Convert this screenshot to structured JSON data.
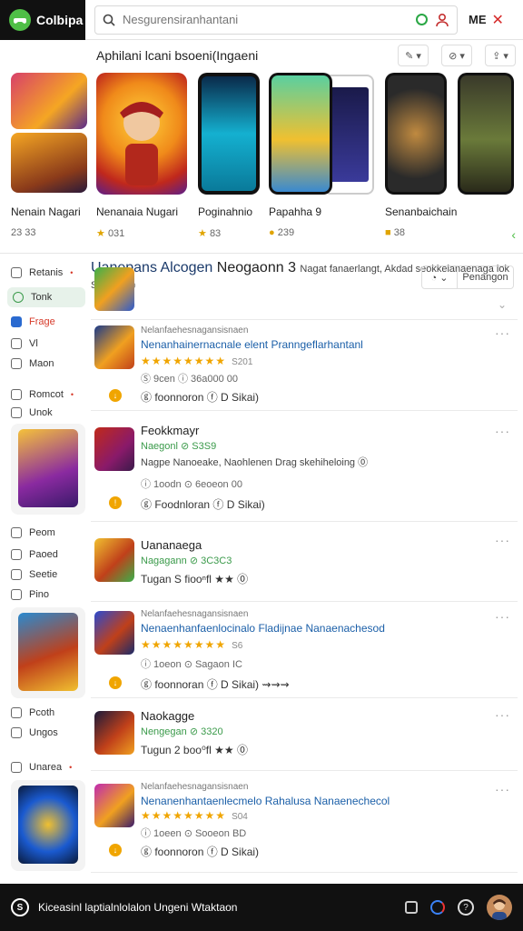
{
  "app": {
    "logo_text": "Colbipa"
  },
  "search": {
    "placeholder": "Nesgurensiranhantani"
  },
  "topbar": {
    "right_label": "ME",
    "close_glyph": "✕"
  },
  "featured": {
    "title": "Aphilani lcani bsoeni(Ingaeni",
    "actions": [
      "✎ ▾",
      "⊘ ▾",
      "⇪ ▾"
    ],
    "cards": [
      {
        "name": "Nenain Nagari",
        "meta_icon": "",
        "meta": "23 33",
        "colors": [
          "#d8406a",
          "#f5a623",
          "#5a2a8a"
        ]
      },
      {
        "name": "Nenanaia Nugari",
        "meta_icon": "★",
        "meta": "031",
        "colors": [
          "#f08a1a",
          "#c0281c",
          "#5a1e8c"
        ]
      },
      {
        "name": "Poginahnio",
        "meta_icon": "★",
        "meta": "83",
        "colors": [
          "#0a7a9a",
          "#14b0d0",
          "#0a2a4a"
        ]
      },
      {
        "name": "Papahha 9",
        "meta_icon": "●",
        "meta": "239",
        "colors": [
          "#5ad0a0",
          "#f0c030",
          "#3a8ad0"
        ]
      },
      {
        "name": "Senanbaichain",
        "meta_icon": "■",
        "meta": "38",
        "colors": [
          "#2a2a2a",
          "#c08a40",
          "#6a6a6a"
        ]
      }
    ]
  },
  "sidebar": {
    "items": [
      {
        "label": "Retanis",
        "marker": "•"
      },
      {
        "label": "Tonk",
        "marker": ""
      },
      {
        "label": "Frage",
        "marker": ""
      },
      {
        "label": "Vl",
        "marker": ""
      },
      {
        "label": "Maon",
        "marker": ""
      },
      {
        "label": "Romcot",
        "marker": "•"
      },
      {
        "label": "Unok",
        "marker": ""
      },
      {
        "label": "Peom",
        "marker": ""
      },
      {
        "label": "Paoed",
        "marker": ""
      },
      {
        "label": "Seetie",
        "marker": ""
      },
      {
        "label": "Pino",
        "marker": ""
      },
      {
        "label": "Pcoth",
        "marker": ""
      },
      {
        "label": "Ungos",
        "marker": ""
      },
      {
        "label": "Unarea",
        "marker": "•"
      }
    ]
  },
  "list": {
    "first": {
      "title": "Uanepans Alcogen",
      "sub": "Neogaonn 3",
      "desc": "Nagat fanaerlangt, Akdad seokkelanaenaga lok Sinpe",
      "desc_suffix": "ooo",
      "btn_icon": "◔ ⌄",
      "btn_label": "Penangon"
    },
    "rows": [
      {
        "kind": "detail",
        "small": "Nelanfaehesnagansisnaen",
        "blue": "Nenanhainernacnale elent Pranngeflarhantanl",
        "stars": "★★★★★★★★",
        "stars_num": "S201",
        "meta": "Ⓢ 9cen ⓘ 36a000 00",
        "foot": "ⓖ foonnoron ⓕ D Sikai)",
        "coin": "↓"
      },
      {
        "kind": "simple",
        "title": "Feokkmayr",
        "sub": "Naegonl ⊘ S3S9",
        "desc": "Nagpe Nanoeake, Naohlenen Drag skehiheloing ⓪",
        "meta": "ⓘ 1oodn ⊙ 6eoeon 00",
        "foot": "ⓖ Foodnloran ⓕ D Sikai)",
        "coin": "!"
      },
      {
        "kind": "simple",
        "title": "Uananaega",
        "sub": "Nagagann ⊘ 3C3C3",
        "desc": "Tugan S fiooⁿfl ★★ ⓪",
        "meta": "",
        "foot": "",
        "coin": ""
      },
      {
        "kind": "detail",
        "small": "Nelanfaehesnagansisnaen",
        "blue": "Nenaenhanfaenlocinalo Fladijnae Nanaenachesod",
        "stars": "★★★★★★★★",
        "stars_num": "S6",
        "meta": "ⓘ 1oeon ⊙ Sagaon IC",
        "foot": "ⓖ foonnoran ⓕ D Sikai) ⇝⇝⇝",
        "coin": "↓"
      },
      {
        "kind": "simple",
        "title": "Naokagge",
        "sub": "Nengegan ⊘ 3320",
        "desc": "Tugun 2 boo⁰fl ★★ ⓪",
        "meta": "",
        "foot": "",
        "coin": ""
      },
      {
        "kind": "detail",
        "small": "Nelanfaehesnagansisnaen",
        "blue": "Nenanenhantaenlecmelo Rahalusa Nanaenechecol",
        "stars": "★★★★★★★★",
        "stars_num": "S04",
        "meta": "ⓘ 1oeen ⊙ Sooeon BD",
        "foot": "ⓖ foonnoron ⓕ D Sikai)",
        "coin": "↓"
      }
    ]
  },
  "bottombar": {
    "icon_letter": "S",
    "text": "Kiceasinl laptialnlolalon Ungeni Wtaktaon"
  },
  "colors": {
    "accent": "#4fbf46",
    "link_blue": "#1b5fa8",
    "star": "#f0a500",
    "danger": "#d62a2a"
  }
}
